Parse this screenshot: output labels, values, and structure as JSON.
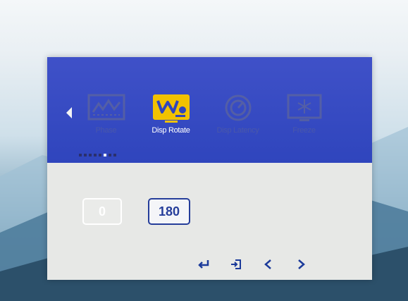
{
  "background": {
    "description_colors": {
      "sky": "#eef3f6",
      "mountain": "#5a88a7"
    }
  },
  "osd_menu": {
    "colors": {
      "top_panel": "#3549c2",
      "panel": "#e7e8e6",
      "accent": "#f2c200",
      "selected_border": "#253d9a"
    },
    "menu_items": [
      {
        "label": "Phase",
        "icon": "phase-wave-icon",
        "state": "dim"
      },
      {
        "label": "Disp Rotate",
        "icon": "rotate-monitor-icon",
        "state": "active"
      },
      {
        "label": "Disp Latency",
        "icon": "latency-gauge-icon",
        "state": "dim"
      },
      {
        "label": "Freeze",
        "icon": "freeze-snowflake-icon",
        "state": "dim"
      }
    ],
    "page_indicator": {
      "total": 8,
      "active_index": 5
    },
    "options": [
      {
        "label": "0",
        "selected": false
      },
      {
        "label": "180",
        "selected": true
      }
    ],
    "keys": [
      "enter-icon",
      "exit-icon",
      "left-arrow-icon",
      "right-arrow-icon"
    ]
  }
}
